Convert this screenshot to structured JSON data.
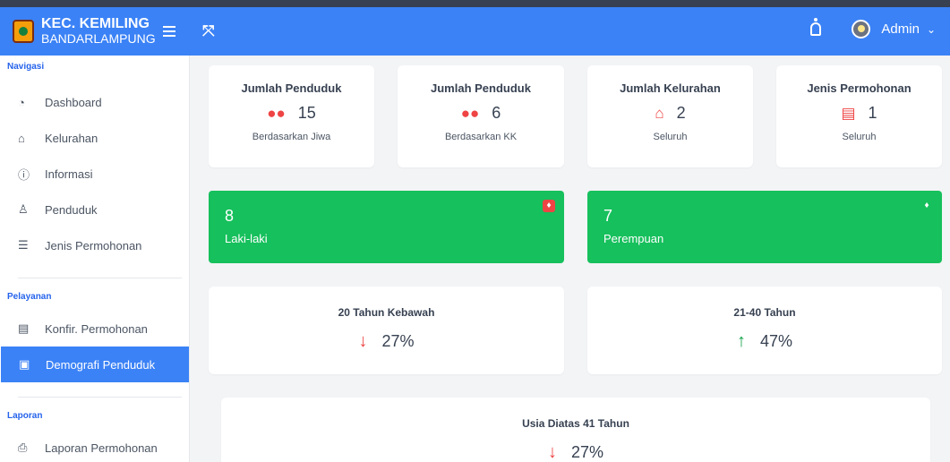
{
  "header": {
    "brand_title": "KEC. KEMILING",
    "brand_sub": "BANDARLAMPUNG",
    "user": "Admin"
  },
  "sidebar": {
    "sections": [
      {
        "label": "Navigasi",
        "items": [
          {
            "icon": "dashboard-icon",
            "label": "Dashboard"
          },
          {
            "icon": "home-icon",
            "label": "Kelurahan"
          },
          {
            "icon": "info-icon",
            "label": "Informasi"
          },
          {
            "icon": "user-icon",
            "label": "Penduduk"
          },
          {
            "icon": "list-icon",
            "label": "Jenis Permohonan"
          }
        ]
      },
      {
        "label": "Pelayanan",
        "items": [
          {
            "icon": "document-icon",
            "label": "Konfir. Permohonan"
          },
          {
            "icon": "building-icon",
            "label": "Demografi Penduduk",
            "active": true
          }
        ]
      },
      {
        "label": "Laporan",
        "items": [
          {
            "icon": "printer-icon",
            "label": "Laporan Permohonan"
          }
        ]
      }
    ]
  },
  "stats": [
    {
      "title": "Jumlah Penduduk",
      "value": "15",
      "sub": "Berdasarkan Jiwa",
      "icon": "users-icon",
      "color": "#ef4444"
    },
    {
      "title": "Jumlah Penduduk",
      "value": "6",
      "sub": "Berdasarkan KK",
      "icon": "users-icon",
      "color": "#ef4444"
    },
    {
      "title": "Jumlah Kelurahan",
      "value": "2",
      "sub": "Seluruh",
      "icon": "home-icon",
      "color": "#ef4444"
    },
    {
      "title": "Jenis Permohonan",
      "value": "1",
      "sub": "Seluruh",
      "icon": "list-alt-icon",
      "color": "#ef4444"
    }
  ],
  "gender": [
    {
      "value": "8",
      "label": "Laki-laki",
      "icon": "male-icon"
    },
    {
      "value": "7",
      "label": "Perempuan",
      "icon": "female-icon"
    }
  ],
  "ages": [
    {
      "title": "20 Tahun Kebawah",
      "value": "27%",
      "direction": "down",
      "color": "#ef4444"
    },
    {
      "title": "21-40 Tahun",
      "value": "47%",
      "direction": "up",
      "color": "#16a34a"
    },
    {
      "title": "Usia Diatas 41 Tahun",
      "value": "27%",
      "direction": "down",
      "color": "#ef4444"
    }
  ],
  "colors": {
    "primary": "#3b82f6",
    "success": "#16c05c",
    "danger": "#ef4444"
  }
}
